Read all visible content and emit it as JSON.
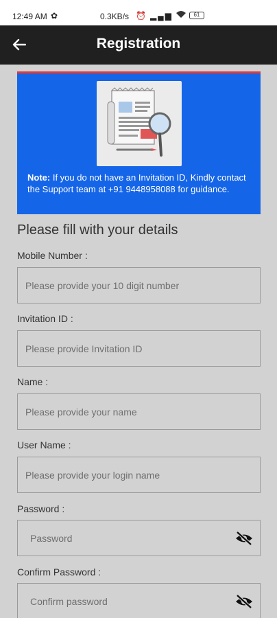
{
  "status_bar": {
    "time": "12:49 AM",
    "network_speed": "0.3KB/s",
    "battery": "61",
    "icons": [
      "settings-icon",
      "alarm-icon",
      "signal-icon",
      "wifi-icon",
      "battery-icon"
    ]
  },
  "app_bar": {
    "title": "Registration",
    "back_icon": "arrow-left-icon"
  },
  "banner": {
    "note_label": "Note:",
    "note_text": " If you do not have an Invitation ID, Kindly contact the Support team at +91 9448958088 for guidance.",
    "bg_color": "#1565e8",
    "accent_color": "#e53935"
  },
  "form": {
    "heading": "Please fill with your details",
    "fields": [
      {
        "label": "Mobile Number :",
        "placeholder": "Please provide your 10 digit number",
        "value": ""
      },
      {
        "label": "Invitation ID :",
        "placeholder": "Please provide Invitation ID",
        "value": ""
      },
      {
        "label": "Name :",
        "placeholder": "Please provide your name",
        "value": ""
      },
      {
        "label": "User Name :",
        "placeholder": "Please provide your login name",
        "value": ""
      },
      {
        "label": "Password :",
        "placeholder": "Password",
        "value": ""
      },
      {
        "label": "Confirm Password :",
        "placeholder": "Confirm password",
        "value": ""
      }
    ]
  }
}
